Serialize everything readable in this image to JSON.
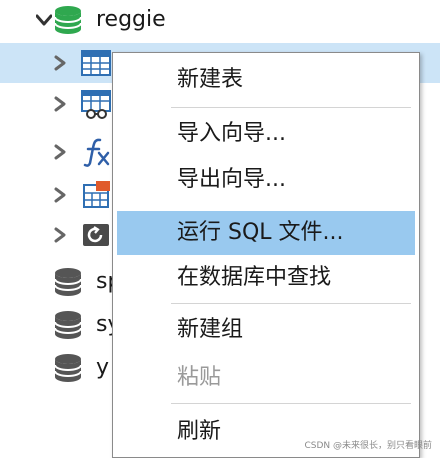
{
  "tree": {
    "root": {
      "label": "reggie",
      "icon": "database-icon",
      "color": "#2fa84f"
    },
    "children": [
      {
        "label": "",
        "icon": "table-icon",
        "selected": true
      },
      {
        "label": "",
        "icon": "view-icon"
      },
      {
        "label": "",
        "icon": "function-icon"
      },
      {
        "label": "",
        "icon": "event-icon"
      },
      {
        "label": "",
        "icon": "backup-icon"
      }
    ],
    "databases": [
      {
        "label": "sp",
        "icon": "database-icon"
      },
      {
        "label": "sy",
        "icon": "database-icon"
      },
      {
        "label": "y",
        "icon": "database-icon"
      }
    ]
  },
  "context_menu": {
    "items": [
      {
        "label": "新建表"
      },
      {
        "label": "导入向导..."
      },
      {
        "label": "导出向导..."
      },
      {
        "label": "运行 SQL 文件...",
        "highlighted": true
      },
      {
        "label": "在数据库中查找"
      },
      {
        "label": "新建组"
      },
      {
        "label": "粘贴",
        "disabled": true
      },
      {
        "label": "刷新"
      }
    ],
    "highlight_color": "#99c9ef"
  },
  "watermark": "CSDN @未来很长，别只看眼前"
}
